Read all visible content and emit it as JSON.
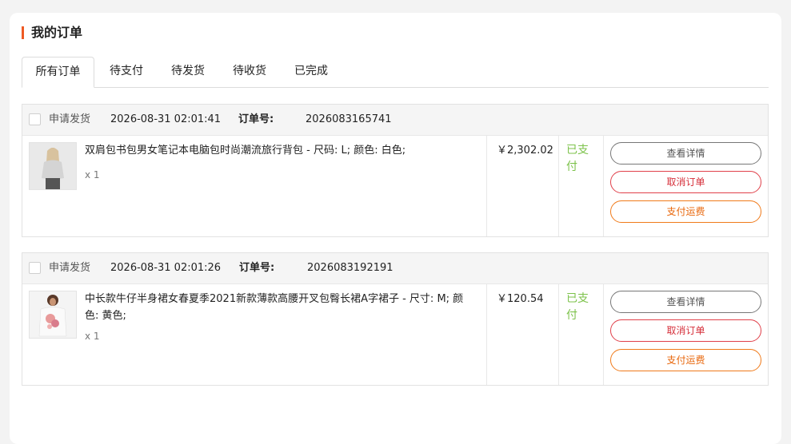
{
  "header": {
    "title": "我的订单"
  },
  "tabs": [
    {
      "label": "所有订单",
      "active": true
    },
    {
      "label": "待支付"
    },
    {
      "label": "待发货"
    },
    {
      "label": "待收货"
    },
    {
      "label": "已完成"
    }
  ],
  "labels": {
    "apply_ship": "申请发货",
    "order_no_label": "订单号:",
    "btn_detail": "查看详情",
    "btn_cancel": "取消订单",
    "btn_pay": "支付运费"
  },
  "orders": [
    {
      "time": "2026-08-31 02:01:41",
      "order_no": "2026083165741",
      "product_name": "双肩包书包男女笔记本电脑包时尚潮流旅行背包 - 尺码: L; 颜色: 白色;",
      "quantity": "x 1",
      "price": "￥2,302.02",
      "status": "已支付",
      "thumb_icon": "product-thumbnail"
    },
    {
      "time": "2026-08-31 02:01:26",
      "order_no": "2026083192191",
      "product_name": "中长款牛仔半身裙女春夏季2021新款薄款高腰开叉包臀长裙A字裙子 - 尺寸: M; 颜色: 黄色;",
      "quantity": "x 1",
      "price": "￥120.54",
      "status": "已支付",
      "thumb_icon": "product-thumbnail"
    }
  ],
  "colors": {
    "accent": "#ee5a24",
    "status_paid": "#7cc24a",
    "cancel": "#d62f3a",
    "pay": "#e8660a"
  }
}
